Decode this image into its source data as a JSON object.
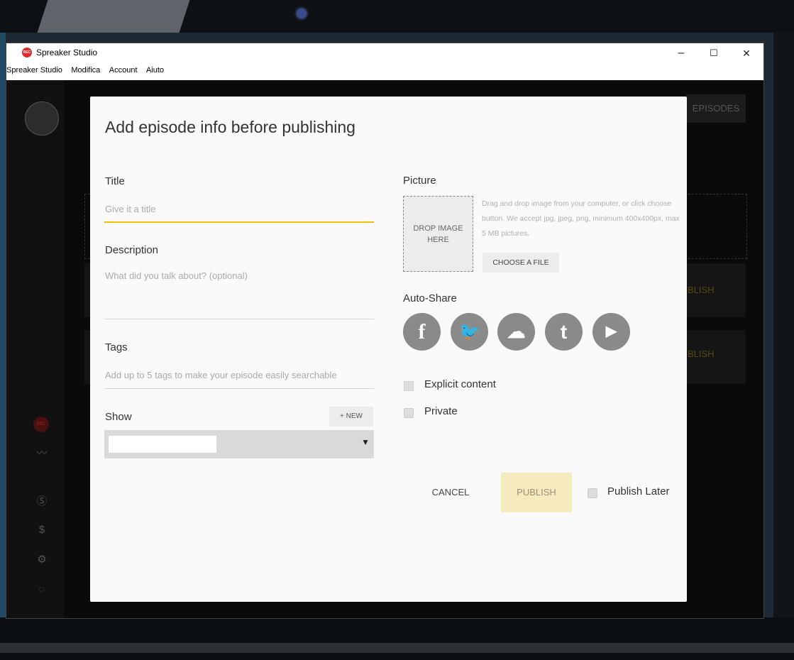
{
  "window": {
    "title": "Spreaker Studio",
    "app_icon_text": "REC",
    "controls": {
      "minimize": "–",
      "maximize": "☐",
      "close": "✕"
    }
  },
  "menu": [
    "Spreaker Studio",
    "Modifica",
    "Account",
    "Aiuto"
  ],
  "background": {
    "episodes_label": "EPISODES",
    "publish_label": "BLISH",
    "rec_label": "REC"
  },
  "modal": {
    "heading": "Add episode info before publishing",
    "title_label": "Title",
    "title_placeholder": "Give it a title",
    "description_label": "Description",
    "description_placeholder": "What did you talk about? (optional)",
    "tags_label": "Tags",
    "tags_placeholder": "Add up to 5 tags to make your episode easily searchable",
    "show_label": "Show",
    "new_button": "+ NEW",
    "show_value": "",
    "picture_label": "Picture",
    "drop_zone": "DROP IMAGE HERE",
    "picture_help": "Drag and drop image from your computer, or click choose button. We accept jpg, jpeg, png, minimum 400x400px, max 5 MB pictures.",
    "choose_file": "CHOOSE A FILE",
    "auto_share_label": "Auto-Share",
    "social": [
      {
        "name": "facebook",
        "glyph": "f"
      },
      {
        "name": "twitter",
        "glyph": "🐦"
      },
      {
        "name": "soundcloud",
        "glyph": "☁"
      },
      {
        "name": "tumblr",
        "glyph": "t"
      },
      {
        "name": "youtube",
        "glyph": "▶"
      }
    ],
    "explicit_label": "Explicit content",
    "private_label": "Private",
    "cancel": "CANCEL",
    "publish": "PUBLISH",
    "publish_later": "Publish Later"
  },
  "colors": {
    "accent_yellow": "#f0c000",
    "publish_bg": "#f6ebbf",
    "rec_red": "#e02b2b"
  }
}
